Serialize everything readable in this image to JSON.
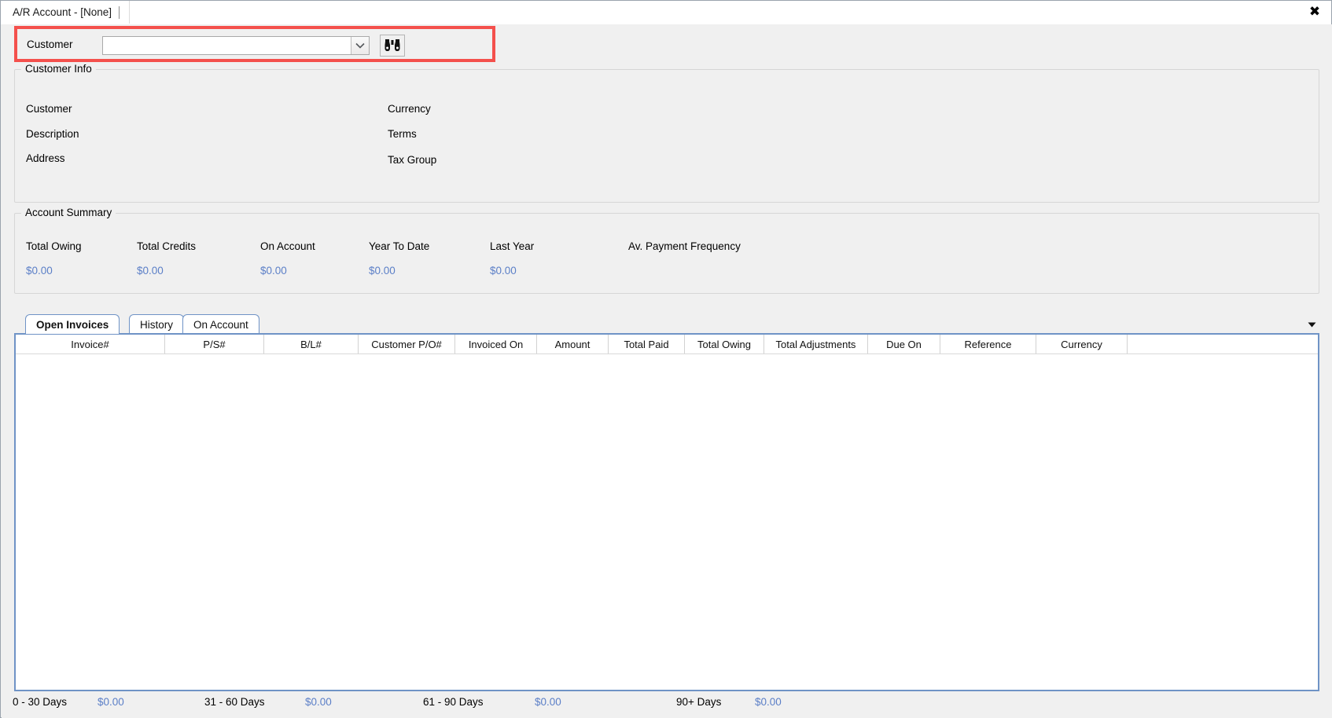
{
  "window": {
    "tab_title": "A/R Account - [None]",
    "close_icon": "close-icon"
  },
  "customer_search": {
    "label": "Customer",
    "value": "",
    "placeholder": "",
    "dropdown_icon": "chevron-down-icon",
    "search_icon": "binoculars-icon",
    "highlight_color": "#f4504c"
  },
  "customer_info": {
    "title": "Customer Info",
    "fields_left": [
      {
        "label": "Customer",
        "value": ""
      },
      {
        "label": "Description",
        "value": ""
      },
      {
        "label": "Address",
        "value": ""
      }
    ],
    "fields_right": [
      {
        "label": "Currency",
        "value": ""
      },
      {
        "label": "Terms",
        "value": ""
      },
      {
        "label": "Tax Group",
        "value": ""
      }
    ]
  },
  "account_summary": {
    "title": "Account Summary",
    "columns": [
      {
        "label": "Total Owing",
        "value": "$0.00"
      },
      {
        "label": "Total Credits",
        "value": "$0.00"
      },
      {
        "label": "On Account",
        "value": "$0.00"
      },
      {
        "label": "Year To Date",
        "value": "$0.00"
      },
      {
        "label": "Last Year",
        "value": "$0.00"
      },
      {
        "label": "Av. Payment Frequency",
        "value": ""
      }
    ],
    "value_color": "#5b7fc7"
  },
  "tabs": {
    "items": [
      {
        "label": "Open Invoices",
        "active": true
      },
      {
        "label": "History",
        "active": false
      },
      {
        "label": "On Account",
        "active": false
      }
    ],
    "overflow_icon": "chevron-down-icon"
  },
  "invoice_grid": {
    "columns": [
      "Invoice#",
      "P/S#",
      "B/L#",
      "Customer P/O#",
      "Invoiced On",
      "Amount",
      "Total Paid",
      "Total Owing",
      "Total Adjustments",
      "Due On",
      "Reference",
      "Currency"
    ],
    "rows": []
  },
  "aging": [
    {
      "label": "0 - 30 Days",
      "value": "$0.00"
    },
    {
      "label": "31 - 60 Days",
      "value": "$0.00"
    },
    {
      "label": "61 - 90 Days",
      "value": "$0.00"
    },
    {
      "label": "90+ Days",
      "value": "$0.00"
    }
  ]
}
